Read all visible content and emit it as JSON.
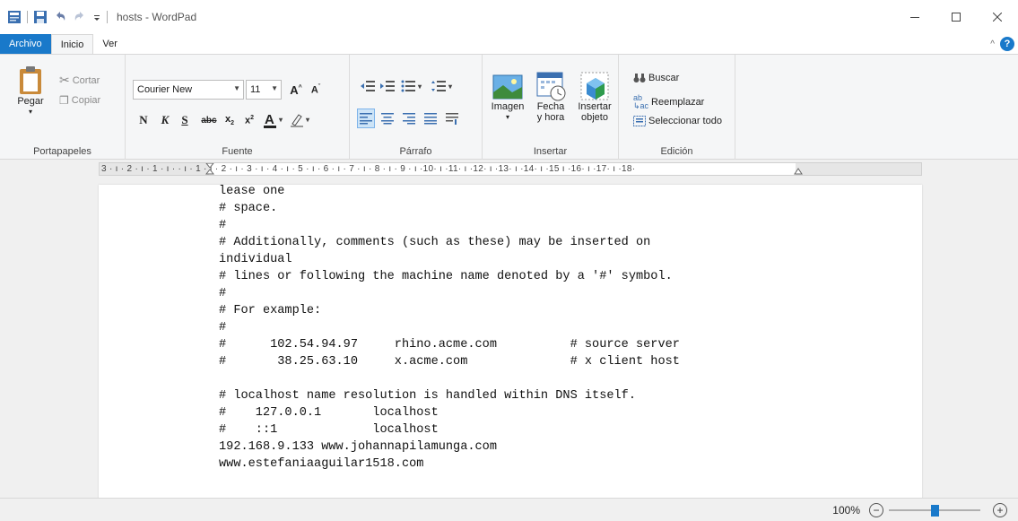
{
  "window": {
    "title": "hosts - WordPad",
    "controls": [
      "minimize-icon",
      "maximize-icon",
      "close-icon"
    ]
  },
  "tabs": [
    {
      "label": "Archivo",
      "kind": "file"
    },
    {
      "label": "Inicio",
      "kind": "active"
    },
    {
      "label": "Ver",
      "kind": "normal"
    }
  ],
  "ribbon": {
    "clipboard": {
      "paste_label": "Pegar",
      "cut_label": "Cortar",
      "copy_label": "Copiar",
      "group_label": "Portapapeles"
    },
    "font": {
      "family": "Courier New",
      "size": "11",
      "bold_label": "N",
      "italic_label": "K",
      "underline_label": "S",
      "strike_label": "abc",
      "group_label": "Fuente"
    },
    "paragraph": {
      "group_label": "Párrafo"
    },
    "insert": {
      "image_label": "Imagen",
      "datetime_label_1": "Fecha",
      "datetime_label_2": "y hora",
      "object_label_1": "Insertar",
      "object_label_2": "objeto",
      "group_label": "Insertar"
    },
    "edit": {
      "find_label": "Buscar",
      "replace_label": "Reemplazar",
      "select_all_label": "Seleccionar todo",
      "group_label": "Edición"
    }
  },
  "ruler": {
    "text": "3 · ı · 2 · ı · 1 · ı ·   · ı · 1 · ı · 2 · ı · 3 · ı · 4 · ı · 5 · ı · 6 · ı · 7 · ı · 8 · ı · 9 · ı ·10· ı ·11· ı ·12· ı ·13· ı ·14· ı ·15   ı ·16· ı ·17· ı ·18·"
  },
  "document": {
    "lines": [
      "lease one",
      "# space.",
      "#",
      "# Additionally, comments (such as these) may be inserted on",
      "individual",
      "# lines or following the machine name denoted by a '#' symbol.",
      "#",
      "# For example:",
      "#",
      "#      102.54.94.97     rhino.acme.com          # source server",
      "#       38.25.63.10     x.acme.com              # x client host",
      "",
      "# localhost name resolution is handled within DNS itself.",
      "#    127.0.0.1       localhost",
      "#    ::1             localhost",
      "192.168.9.133 www.johannapilamunga.com",
      "www.estefaniaaguilar1518.com"
    ]
  },
  "status": {
    "zoom_text": "100%",
    "zoom_out": "−",
    "zoom_in": "+",
    "zoom_level": 0.5
  },
  "colors": {
    "accent": "#1979ca",
    "ribbon_bg": "#f5f6f7",
    "doc_bg": "#f0f0f0"
  }
}
